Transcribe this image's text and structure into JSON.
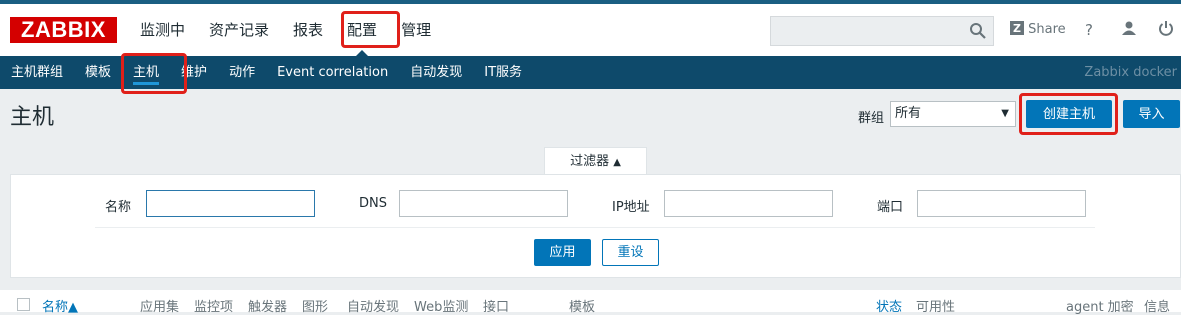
{
  "logo": "ZABBIX",
  "main_menu": [
    "监测中",
    "资产记录",
    "报表",
    "配置",
    "管理"
  ],
  "main_menu_active": "配置",
  "search": {
    "placeholder": "",
    "icon": "search-icon"
  },
  "tools": {
    "share_label": "Share",
    "share_icon": "zabbix-share-icon",
    "help": "?",
    "user_icon": "user-icon",
    "power_icon": "power-icon"
  },
  "sub_menu": [
    "主机群组",
    "模板",
    "主机",
    "维护",
    "动作",
    "Event correlation",
    "自动发现",
    "IT服务"
  ],
  "sub_menu_active": "主机",
  "brand_text": "Zabbix docker",
  "page": {
    "title": "主机",
    "group_label": "群组",
    "group_value": "所有",
    "create_button": "创建主机",
    "import_button": "导入"
  },
  "filter": {
    "tab_label": "过滤器",
    "tab_icon": "triangle-up-icon",
    "fields": [
      {
        "label": "名称",
        "value": ""
      },
      {
        "label": "DNS",
        "value": ""
      },
      {
        "label": "IP地址",
        "value": ""
      },
      {
        "label": "端口",
        "value": ""
      }
    ],
    "apply_button": "应用",
    "reset_button": "重设"
  },
  "table": {
    "columns": [
      "名称▲",
      "应用集",
      "监控项",
      "触发器",
      "图形",
      "自动发现",
      "Web监测",
      "接口",
      "模板",
      "状态",
      "可用性",
      "agent 加密",
      "信息"
    ]
  },
  "colors": {
    "accent": "#0275b8",
    "header": "#0e4a6b",
    "logo": "#d40000",
    "highlight": "#e0201a"
  }
}
